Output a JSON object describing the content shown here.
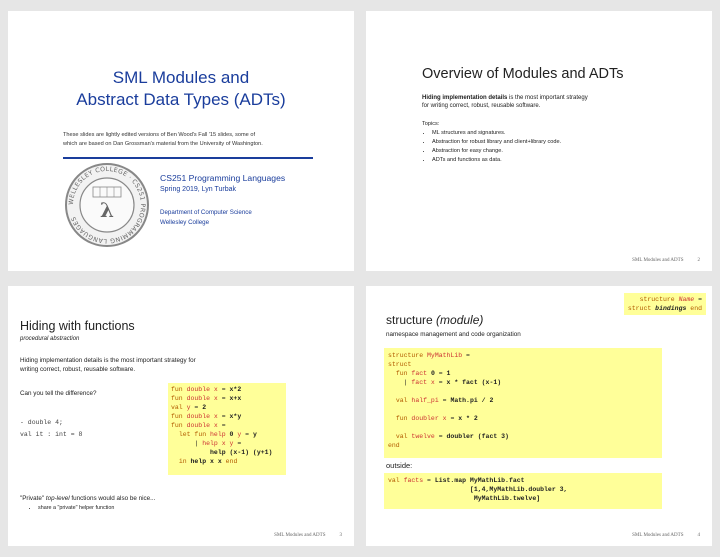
{
  "slide1": {
    "title_line1": "SML Modules and",
    "title_line2": "Abstract Data Types (ADTs)",
    "note_line1": "These slides are lightly edited versions of Ben Wood's Fall '15 slides, some of",
    "note_line2": "which are based on Dan Grossman's material from the University of Washington.",
    "course": "CS251 Programming Languages",
    "term": "Spring 2019, Lyn Turbak",
    "dept": "Department of Computer Science",
    "college": "Wellesley College",
    "seal_text": "WELLESLEY COLLEGE · CS251 PROGRAMMING LANGUAGES"
  },
  "slide2": {
    "title": "Overview of Modules and ADTs",
    "intro_bold": "Hiding implementation details",
    "intro_rest1": " is the most important strategy",
    "intro_rest2": "for writing correct, robust, reusable software.",
    "topics_label": "Topics:",
    "topics": [
      "ML structures and signatures.",
      "Abstraction for robust library and client+library code.",
      "Abstraction for easy change.",
      "ADTs and functions as data."
    ],
    "footer": "SML Modules and ADTS",
    "page": "2"
  },
  "slide3": {
    "title": "Hiding with functions",
    "subtitle": "procedural abstraction",
    "body_line1": "Hiding implementation details is the most important strategy for",
    "body_line2": "writing correct, robust, reusable software.",
    "question": "Can you tell the difference?",
    "repl1": "- double 4;",
    "repl2": "val it : int = 8",
    "private_pre": "\"Private\" ",
    "private_em": "top-level",
    "private_post": " functions would also be nice...",
    "bullet": "share a \"private\" helper function",
    "footer": "SML Modules and ADTS",
    "page": "3"
  },
  "slide4": {
    "sig_line1": "structure Name =",
    "sig_line2": "struct bindings end",
    "title": "structure",
    "title_em": "(module)",
    "subtitle": "namespace management and code organization",
    "outside": "outside:",
    "footer": "SML Modules and ADTS",
    "page": "4"
  }
}
